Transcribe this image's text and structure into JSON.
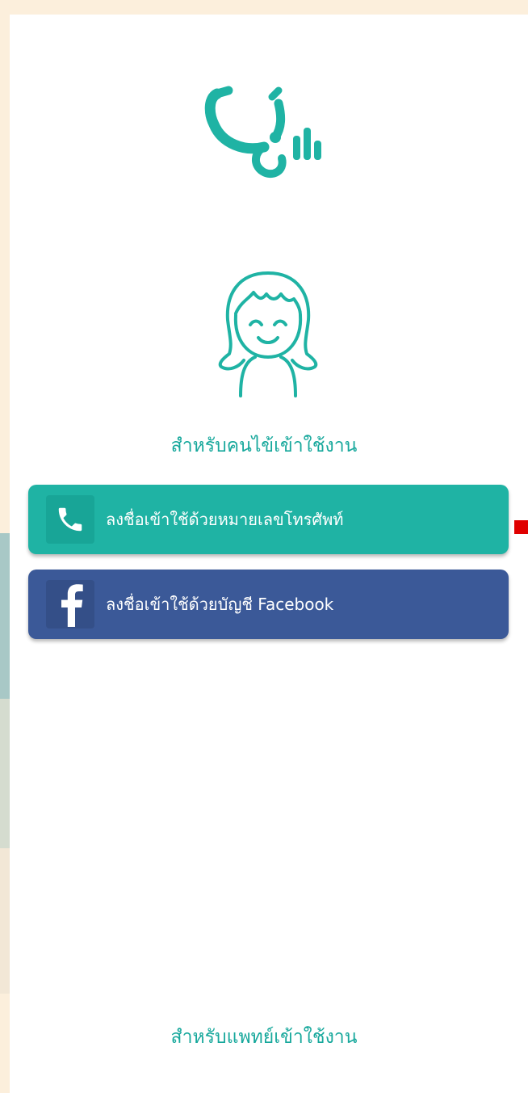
{
  "app": {
    "logo_icon": "stethoscope-icon",
    "accent_color": "#1fb3a4"
  },
  "patient": {
    "avatar_icon": "patient-avatar-icon",
    "title": "สำหรับคนไข้เข้าใช้งาน"
  },
  "buttons": {
    "phone": {
      "icon": "phone-icon",
      "label": "ลงชื่อเข้าใช้ด้วยหมายเลขโทรศัพท์",
      "color": "#1fb3a4"
    },
    "facebook": {
      "icon": "facebook-icon",
      "label": "ลงชื่อเข้าใช้ด้วยบัญชี Facebook",
      "color": "#3b5998"
    }
  },
  "doctor": {
    "link_label": "สำหรับแพทย์เข้าใช้งาน"
  }
}
